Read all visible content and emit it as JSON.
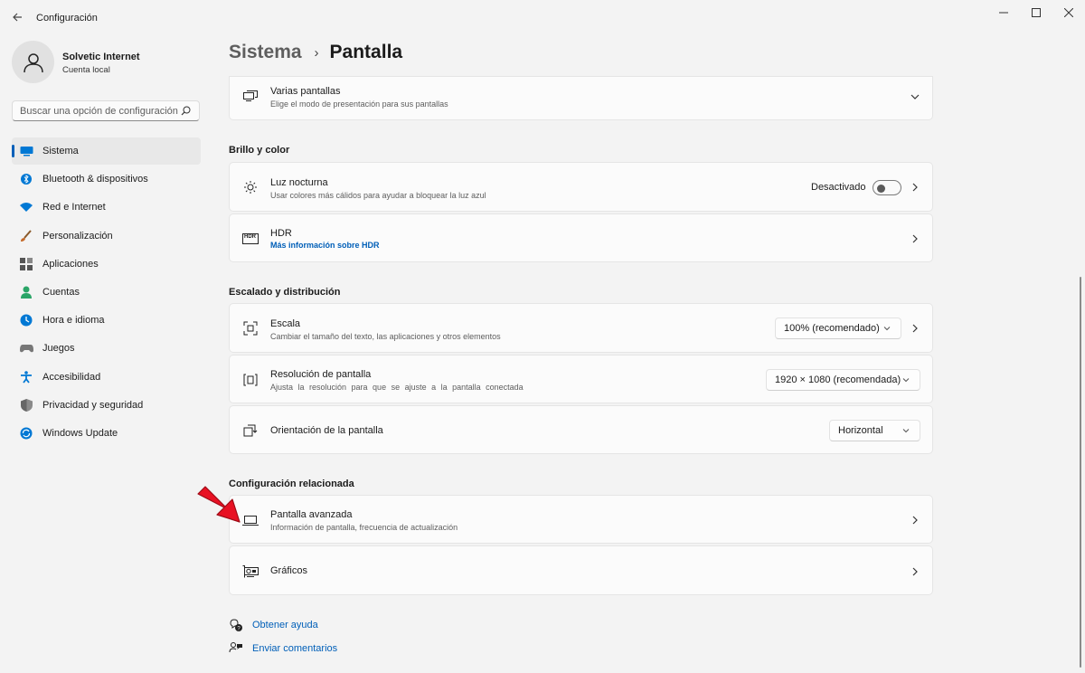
{
  "window": {
    "title": "Configuración"
  },
  "user": {
    "name": "Solvetic Internet",
    "account": "Cuenta local"
  },
  "search": {
    "placeholder": "Buscar una opción de configuración"
  },
  "nav": [
    {
      "label": "Sistema",
      "icon": "monitor-icon",
      "color": "#0078d4"
    },
    {
      "label": "Bluetooth & dispositivos",
      "icon": "bluetooth-icon",
      "color": "#0078d4"
    },
    {
      "label": "Red e Internet",
      "icon": "wifi-icon",
      "color": "#0078d4"
    },
    {
      "label": "Personalización",
      "icon": "brush-icon",
      "color": "#c46a2a"
    },
    {
      "label": "Aplicaciones",
      "icon": "apps-icon",
      "color": "#555555"
    },
    {
      "label": "Cuentas",
      "icon": "person-icon",
      "color": "#2aa567"
    },
    {
      "label": "Hora e idioma",
      "icon": "globe-icon",
      "color": "#0078d4"
    },
    {
      "label": "Juegos",
      "icon": "gamepad-icon",
      "color": "#777777"
    },
    {
      "label": "Accesibilidad",
      "icon": "accessibility-icon",
      "color": "#0078d4"
    },
    {
      "label": "Privacidad y seguridad",
      "icon": "shield-icon",
      "color": "#777777"
    },
    {
      "label": "Windows Update",
      "icon": "update-icon",
      "color": "#0078d4"
    }
  ],
  "breadcrumb": {
    "parent": "Sistema",
    "separator": "›",
    "current": "Pantalla"
  },
  "varias": {
    "title": "Varias pantallas",
    "desc": "Elige el modo de presentación para sus pantallas"
  },
  "sections": {
    "brillo": "Brillo y color",
    "escalado": "Escalado y distribución",
    "relacionada": "Configuración relacionada"
  },
  "luz": {
    "title": "Luz nocturna",
    "desc": "Usar colores más cálidos para ayudar a bloquear la luz azul",
    "state": "Desactivado"
  },
  "hdr": {
    "title": "HDR",
    "link": "Más información sobre HDR",
    "icon_text": "HDR"
  },
  "escala": {
    "title": "Escala",
    "desc": "Cambiar el tamaño del texto, las aplicaciones y otros elementos",
    "value": "100% (recomendado)"
  },
  "resolucion": {
    "title": "Resolución de pantalla",
    "desc": "Ajusta la resolución para que se ajuste a la pantalla conectada",
    "value": "1920 × 1080 (recomendada)"
  },
  "orientacion": {
    "title": "Orientación de la pantalla",
    "value": "Horizontal"
  },
  "avanzada": {
    "title": "Pantalla avanzada",
    "desc": "Información de pantalla, frecuencia de actualización"
  },
  "graficos": {
    "title": "Gráficos"
  },
  "help": {
    "ayuda": "Obtener ayuda",
    "comentarios": "Enviar comentarios"
  },
  "colors": {
    "accent": "#005fb8",
    "arrow": "#e81123"
  }
}
